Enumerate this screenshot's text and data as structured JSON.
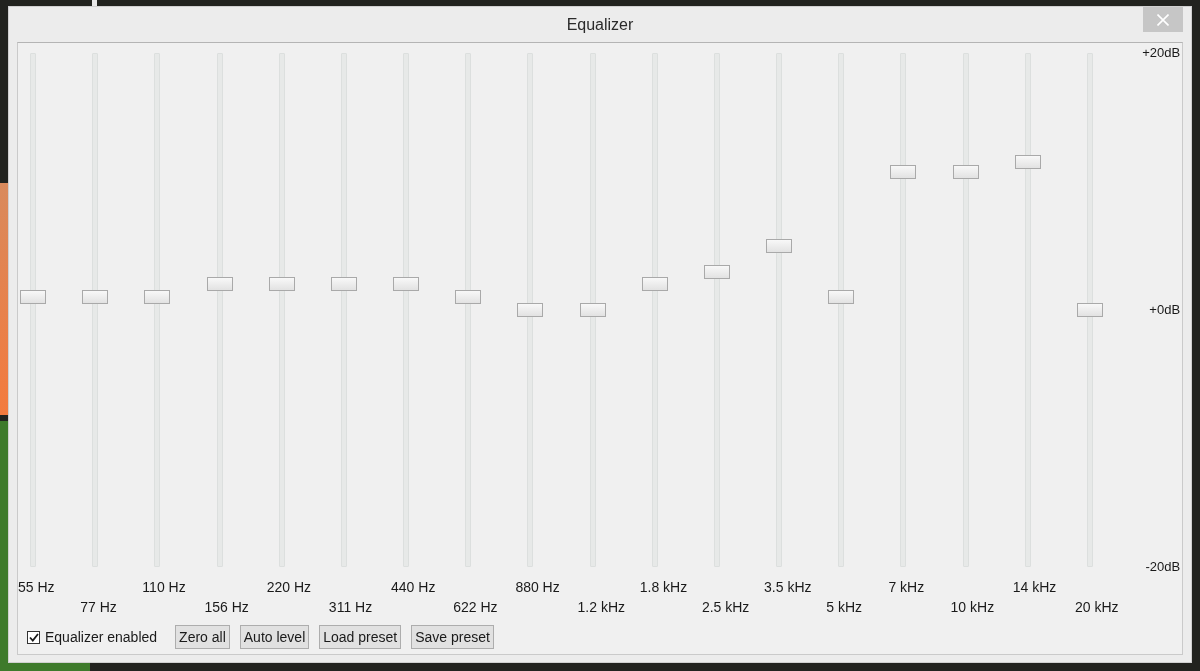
{
  "window": {
    "title": "Equalizer"
  },
  "bands": [
    {
      "label": "55 Hz",
      "level": 0.525
    },
    {
      "label": "77 Hz",
      "level": 0.525
    },
    {
      "label": "110 Hz",
      "level": 0.525
    },
    {
      "label": "156 Hz",
      "level": 0.55
    },
    {
      "label": "220 Hz",
      "level": 0.55
    },
    {
      "label": "311 Hz",
      "level": 0.55
    },
    {
      "label": "440 Hz",
      "level": 0.55
    },
    {
      "label": "622 Hz",
      "level": 0.525
    },
    {
      "label": "880 Hz",
      "level": 0.5
    },
    {
      "label": "1.2 kHz",
      "level": 0.5
    },
    {
      "label": "1.8 kHz",
      "level": 0.55
    },
    {
      "label": "2.5 kHz",
      "level": 0.575
    },
    {
      "label": "3.5 kHz",
      "level": 0.625
    },
    {
      "label": "5 kHz",
      "level": 0.525
    },
    {
      "label": "7 kHz",
      "level": 0.77
    },
    {
      "label": "10 kHz",
      "level": 0.77
    },
    {
      "label": "14 kHz",
      "level": 0.79
    },
    {
      "label": "20 kHz",
      "level": 0.5
    }
  ],
  "scale_labels": [
    "+20dB",
    "+0dB",
    "-20dB"
  ],
  "enabled_checkbox": {
    "label": "Equalizer enabled",
    "checked": true
  },
  "buttons": [
    "Zero all",
    "Auto level",
    "Load preset",
    "Save preset"
  ]
}
